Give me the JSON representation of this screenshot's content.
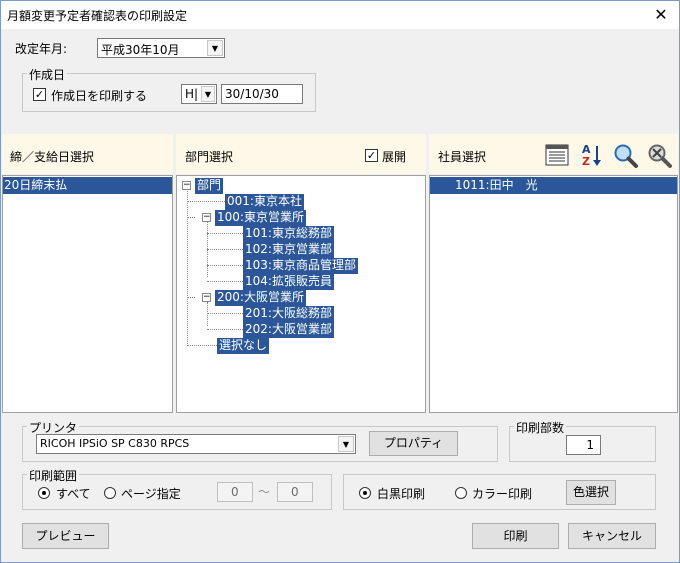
{
  "window": {
    "title": "月額変更予定者確認表の印刷設定",
    "close": "✕"
  },
  "revision": {
    "label": "改定年月:",
    "value": "平成30年10月"
  },
  "created": {
    "group_label": "作成日",
    "print_label": "作成日を印刷する",
    "print_checked": "✓",
    "era": "H|",
    "date": "30/10/30"
  },
  "panels": {
    "closing": {
      "header": "締／支給日選択",
      "items": [
        "20日締末払"
      ]
    },
    "dept": {
      "header": "部門選択",
      "expand_label": "展開",
      "expand_checked": "✓",
      "tree": {
        "root": "部門",
        "n001": "001:東京本社",
        "n100": "100:東京営業所",
        "n101": "101:東京総務部",
        "n102": "102:東京営業部",
        "n103": "103:東京商品管理部",
        "n104": "104:拡張販売員",
        "n200": "200:大阪営業所",
        "n201": "201:大阪総務部",
        "n202": "202:大阪営業部",
        "none": "選択なし"
      }
    },
    "employee": {
      "header": "社員選択",
      "items": [
        "1011:田中　光"
      ]
    }
  },
  "printer": {
    "group_label": "プリンタ",
    "value": "RICOH IPSiO SP C830 RPCS",
    "properties_button": "プロパティ"
  },
  "copies": {
    "group_label": "印刷部数",
    "value": "1"
  },
  "range": {
    "group_label": "印刷範囲",
    "all_label": "すべて",
    "page_label": "ページ指定",
    "from": "0",
    "sep": "～",
    "to": "0"
  },
  "color": {
    "mono_label": "白黒印刷",
    "color_label": "カラー印刷",
    "select_button": "色選択"
  },
  "buttons": {
    "preview": "プレビュー",
    "print": "印刷",
    "cancel": "キャンセル"
  },
  "icons": {
    "list": "list-icon",
    "sort": "sort-az-icon",
    "search": "search-icon",
    "clear": "clear-search-icon"
  }
}
